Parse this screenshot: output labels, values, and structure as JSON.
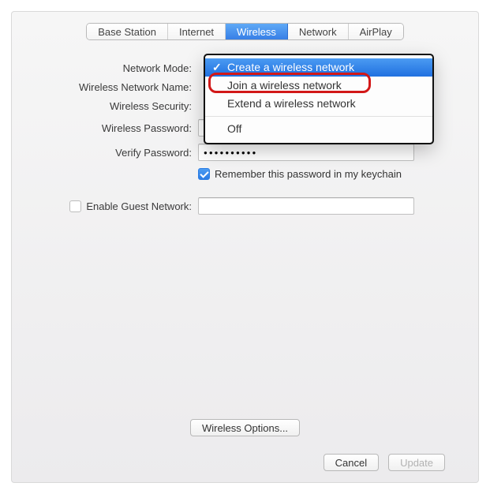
{
  "tabs": {
    "base_station": "Base Station",
    "internet": "Internet",
    "wireless": "Wireless",
    "network": "Network",
    "airplay": "AirPlay"
  },
  "labels": {
    "network_mode": "Network Mode:",
    "wireless_network_name": "Wireless Network Name:",
    "wireless_security": "Wireless Security:",
    "wireless_password": "Wireless Password:",
    "verify_password": "Verify Password:",
    "remember_password": "Remember this password in my keychain",
    "enable_guest_network": "Enable Guest Network:"
  },
  "fields": {
    "wireless_password": "●●●●●●●●●●",
    "verify_password": "●●●●●●●●●●",
    "guest_network_name": ""
  },
  "menu": {
    "items": [
      "Create a wireless network",
      "Join a wireless network",
      "Extend a wireless network"
    ],
    "off": "Off"
  },
  "buttons": {
    "wireless_options": "Wireless Options...",
    "cancel": "Cancel",
    "update": "Update"
  }
}
